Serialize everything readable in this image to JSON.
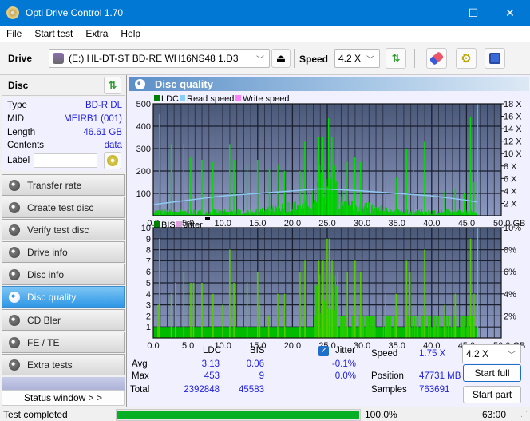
{
  "window": {
    "title": "Opti Drive Control 1.70",
    "minimize": "—",
    "maximize": "☐",
    "close": "✕"
  },
  "menu": [
    "File",
    "Start test",
    "Extra",
    "Help"
  ],
  "toolbar": {
    "drive_label": "Drive",
    "drive_value": "(E:)  HL-DT-ST BD-RE  WH16NS48 1.D3",
    "speed_label": "Speed",
    "speed_value": "4.2 X"
  },
  "disc": {
    "header": "Disc",
    "rows": [
      {
        "key": "Type",
        "value": "BD-R DL"
      },
      {
        "key": "MID",
        "value": "MEIRB1 (001)"
      },
      {
        "key": "Length",
        "value": "46.61 GB"
      },
      {
        "key": "Contents",
        "value": "data"
      }
    ],
    "label_key": "Label",
    "label_value": ""
  },
  "nav": [
    {
      "label": "Transfer rate",
      "active": false
    },
    {
      "label": "Create test disc",
      "active": false
    },
    {
      "label": "Verify test disc",
      "active": false
    },
    {
      "label": "Drive info",
      "active": false
    },
    {
      "label": "Disc info",
      "active": false
    },
    {
      "label": "Disc quality",
      "active": true
    },
    {
      "label": "CD Bler",
      "active": false
    },
    {
      "label": "FE / TE",
      "active": false
    },
    {
      "label": "Extra tests",
      "active": false
    }
  ],
  "status_window_button": "Status window > >",
  "panel_title": "Disc quality",
  "chart_data": [
    {
      "type": "bar",
      "title": "",
      "legend": [
        "LDC",
        "Read speed",
        "Write speed"
      ],
      "legend_colors": [
        "#008000",
        "#87cefa",
        "#ff80ff"
      ],
      "xlabel": "GB",
      "x_ticks": [
        "0.0",
        "5.0",
        "10.0",
        "15.0",
        "20.0",
        "25.0",
        "30.0",
        "35.0",
        "40.0",
        "45.0",
        "50.0 GB"
      ],
      "y_ticks": [
        "100",
        "200",
        "300",
        "400",
        "500"
      ],
      "y2_ticks": [
        "2 X",
        "4 X",
        "6 X",
        "8 X",
        "10 X",
        "12 X",
        "14 X",
        "16 X",
        "18 X"
      ],
      "xlim": [
        0,
        50
      ],
      "ylim": [
        0,
        500
      ],
      "y2lim": [
        0,
        18
      ],
      "disc_end_gb": 46.61,
      "ldc_peaks": [
        [
          0.8,
          453
        ],
        [
          2.5,
          320
        ],
        [
          4.3,
          320
        ],
        [
          5.3,
          260
        ],
        [
          6.9,
          250
        ],
        [
          8.5,
          240
        ],
        [
          10.9,
          320
        ],
        [
          11.5,
          250
        ],
        [
          13.4,
          230
        ],
        [
          14.9,
          250
        ],
        [
          16.6,
          210
        ],
        [
          17.8,
          230
        ],
        [
          18.8,
          200
        ],
        [
          21.0,
          200
        ],
        [
          21.7,
          330
        ],
        [
          22.4,
          240
        ],
        [
          23.7,
          350
        ],
        [
          24.3,
          350
        ],
        [
          25.1,
          435
        ],
        [
          25.6,
          350
        ],
        [
          26.4,
          300
        ],
        [
          27.8,
          240
        ],
        [
          28.9,
          260
        ],
        [
          29.7,
          240
        ],
        [
          33.3,
          170
        ],
        [
          34.8,
          170
        ],
        [
          36.3,
          300
        ],
        [
          37.3,
          240
        ],
        [
          38.9,
          330
        ],
        [
          41.8,
          110
        ],
        [
          43.3,
          120
        ],
        [
          44.6,
          100
        ],
        [
          45.5,
          440
        ],
        [
          46.0,
          150
        ]
      ],
      "read_speed": [
        [
          0,
          1.8
        ],
        [
          5,
          2.5
        ],
        [
          10,
          3.2
        ],
        [
          15,
          3.6
        ],
        [
          20,
          4.0
        ],
        [
          23.6,
          4.3
        ],
        [
          25,
          4.3
        ],
        [
          30,
          4.0
        ],
        [
          35,
          3.6
        ],
        [
          40,
          3.2
        ],
        [
          45,
          2.5
        ],
        [
          46.6,
          2.2
        ]
      ]
    },
    {
      "type": "bar",
      "title": "",
      "legend": [
        "BIS",
        "Jitter"
      ],
      "legend_colors": [
        "#008000",
        "#e0a0e0"
      ],
      "xlabel": "GB",
      "x_ticks": [
        "0.0",
        "5.0",
        "10.0",
        "15.0",
        "20.0",
        "25.0",
        "30.0",
        "35.0",
        "40.0",
        "45.0",
        "50.0 GB"
      ],
      "y_ticks": [
        "1",
        "2",
        "3",
        "4",
        "5",
        "6",
        "7",
        "8",
        "9",
        "10"
      ],
      "y2_ticks": [
        "2%",
        "4%",
        "6%",
        "8%",
        "10%"
      ],
      "xlim": [
        0,
        50
      ],
      "ylim": [
        0,
        10
      ],
      "y2lim": [
        0,
        10
      ],
      "disc_end_gb": 46.61,
      "bis_peaks": [
        [
          0.8,
          9
        ],
        [
          0.6,
          3
        ],
        [
          2.5,
          4
        ],
        [
          3.1,
          5
        ],
        [
          4.3,
          6
        ],
        [
          5.3,
          5
        ],
        [
          5.7,
          5
        ],
        [
          6.9,
          5
        ],
        [
          8.5,
          4
        ],
        [
          9.9,
          3
        ],
        [
          10.9,
          8
        ],
        [
          11.5,
          5
        ],
        [
          13.4,
          5
        ],
        [
          14.9,
          6
        ],
        [
          15.2,
          3
        ],
        [
          16.5,
          2
        ],
        [
          17.8,
          4
        ],
        [
          18.8,
          4
        ],
        [
          21.0,
          6
        ],
        [
          21.7,
          7
        ],
        [
          23.7,
          7
        ],
        [
          24.3,
          7
        ],
        [
          24.9,
          9
        ],
        [
          25.2,
          9
        ],
        [
          25.6,
          7
        ],
        [
          26.4,
          6
        ],
        [
          27.8,
          6
        ],
        [
          28.9,
          7
        ],
        [
          29.7,
          6
        ],
        [
          33.3,
          4
        ],
        [
          34.8,
          4
        ],
        [
          36.3,
          7
        ],
        [
          36.8,
          6
        ],
        [
          38.9,
          8
        ],
        [
          41.8,
          3
        ],
        [
          43.3,
          4
        ],
        [
          45.5,
          9
        ],
        [
          46.0,
          4
        ]
      ],
      "bis_baseline": 1
    }
  ],
  "stats": {
    "col_ldc": "LDC",
    "col_bis": "BIS",
    "rows": [
      {
        "label": "Avg",
        "ldc": "3.13",
        "bis": "0.06"
      },
      {
        "label": "Max",
        "ldc": "453",
        "bis": "9"
      },
      {
        "label": "Total",
        "ldc": "2392848",
        "bis": "45583"
      }
    ],
    "jitter_label": "Jitter",
    "jitter_checked": true,
    "jitter_avg": "-0.1%",
    "jitter_max": "0.0%",
    "speed_label": "Speed",
    "speed_value": "1.75 X",
    "position_label": "Position",
    "position_value": "47731 MB",
    "samples_label": "Samples",
    "samples_value": "763691",
    "speed_select": "4.2 X",
    "start_full": "Start full",
    "start_part": "Start part"
  },
  "statusbar": {
    "text": "Test completed",
    "progress_percent": 100.0,
    "progress_text": "100.0%",
    "time": "63:00"
  }
}
